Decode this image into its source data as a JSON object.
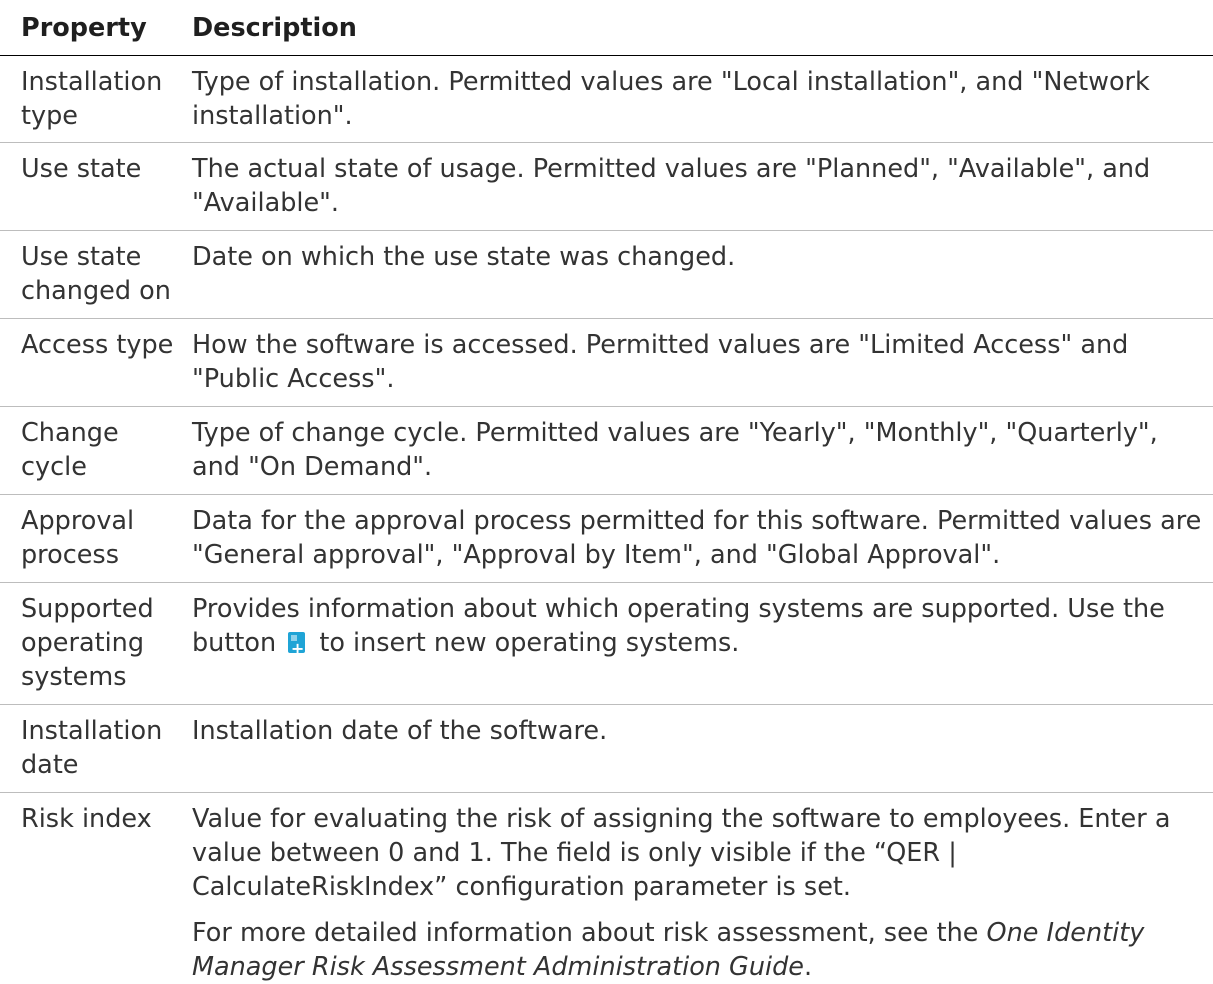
{
  "header": {
    "property": "Property",
    "description": "Description"
  },
  "rows": [
    {
      "property": "Installation type",
      "description": "Type of installation. Permitted values are \"Local installation\", and \"Network installation\"."
    },
    {
      "property": "Use state",
      "description": "The actual state of usage. Permitted values are \"Planned\", \"Available\", and \"Available\"."
    },
    {
      "property": "Use state changed on",
      "description": "Date on which the use state was changed."
    },
    {
      "property": "Access type",
      "description": "How the software is accessed. Permitted values are \"Limited Access\" and \"Public Access\"."
    },
    {
      "property": "Change cycle",
      "description": "Type of change cycle. Permitted values are \"Yearly\", \"Monthly\", \"Quarterly\", and \"On Demand\"."
    },
    {
      "property": "Approval process",
      "description": "Data for the approval process permitted for this software. Permitted values are \"General approval\", \"Approval by Item\", and \"Global Approval\"."
    },
    {
      "property": "Supported operating systems",
      "description_before": "Provides information about which operating systems are supported. Use the button",
      "description_icon": "add-item-icon",
      "description_after": "to insert new operating systems."
    },
    {
      "property": "Installation date",
      "description": "Installation date of the software."
    },
    {
      "property": "Risk index",
      "description": "Value for evaluating the risk of assigning the software to employees. Enter a value between 0 and 1. The field is only visible if the “QER | CalculateRiskIndex” configuration parameter is set.",
      "note_before": "For more detailed information about risk assessment, see the ",
      "note_guide": "One Identity Manager Risk Assessment Administration Guide",
      "note_after": "."
    }
  ],
  "colors": {
    "text": "#333333",
    "icon": "#1fa4d6"
  }
}
